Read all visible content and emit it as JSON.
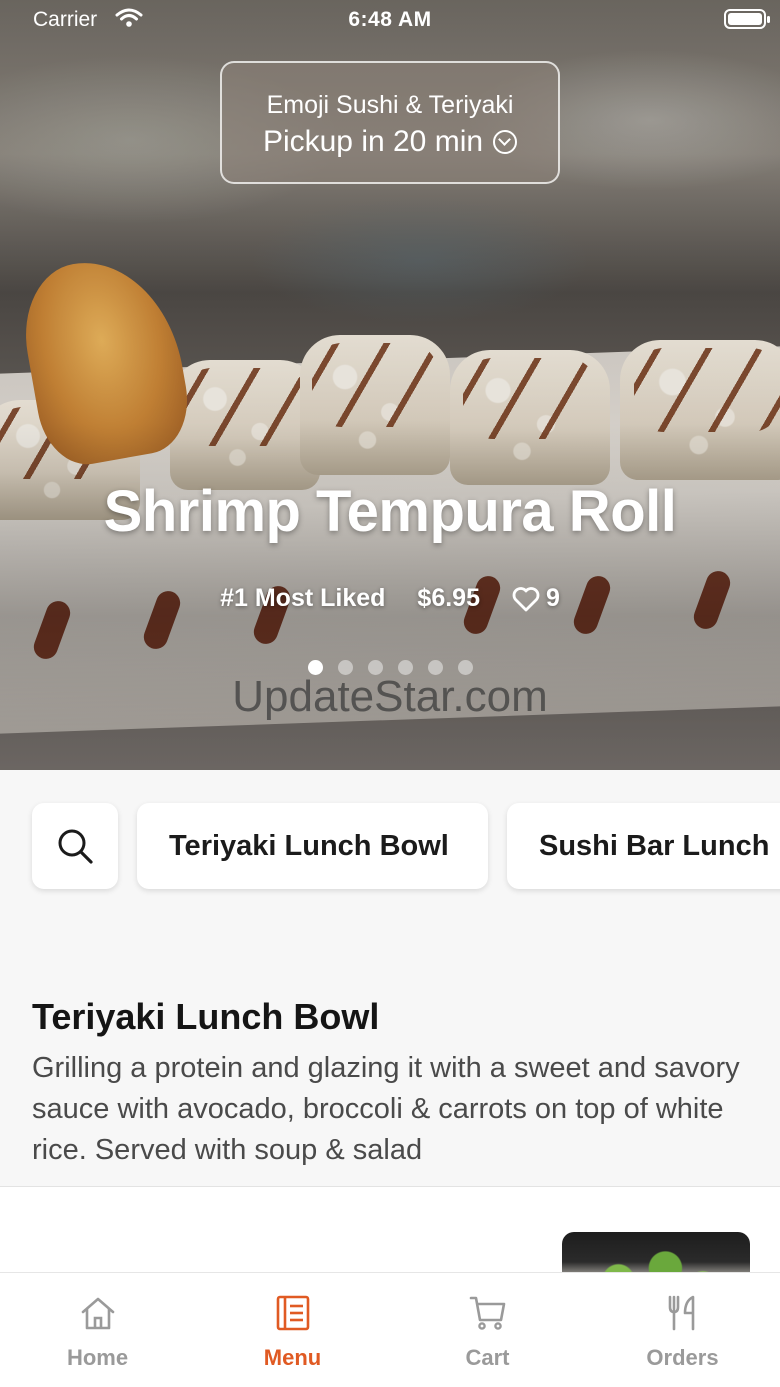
{
  "status_bar": {
    "carrier": "Carrier",
    "time": "6:48 AM"
  },
  "store": {
    "name": "Emoji Sushi & Teriyaki",
    "pickup": "Pickup in 20 min"
  },
  "featured": {
    "title": "Shrimp Tempura Roll",
    "badge": "#1 Most Liked",
    "price": "$6.95",
    "likes": "9",
    "page_count": 6,
    "active_page": 1
  },
  "watermark": "UpdateStar.com",
  "categories": [
    {
      "label": "Teriyaki Lunch Bowl"
    },
    {
      "label": "Sushi Bar Lunch"
    }
  ],
  "section": {
    "title": "Teriyaki Lunch Bowl",
    "description": "Grilling a protein and glazing it with a sweet and savory sauce with avocado, broccoli & carrots on top of white rice. Served with soup & salad"
  },
  "tabs": [
    {
      "label": "Home",
      "icon": "home-icon",
      "active": false
    },
    {
      "label": "Menu",
      "icon": "menu-icon",
      "active": true
    },
    {
      "label": "Cart",
      "icon": "cart-icon",
      "active": false
    },
    {
      "label": "Orders",
      "icon": "utensils-icon",
      "active": false
    }
  ],
  "colors": {
    "accent": "#e05a23",
    "tab_inactive": "#9a9a9a",
    "text_primary": "#151515"
  }
}
